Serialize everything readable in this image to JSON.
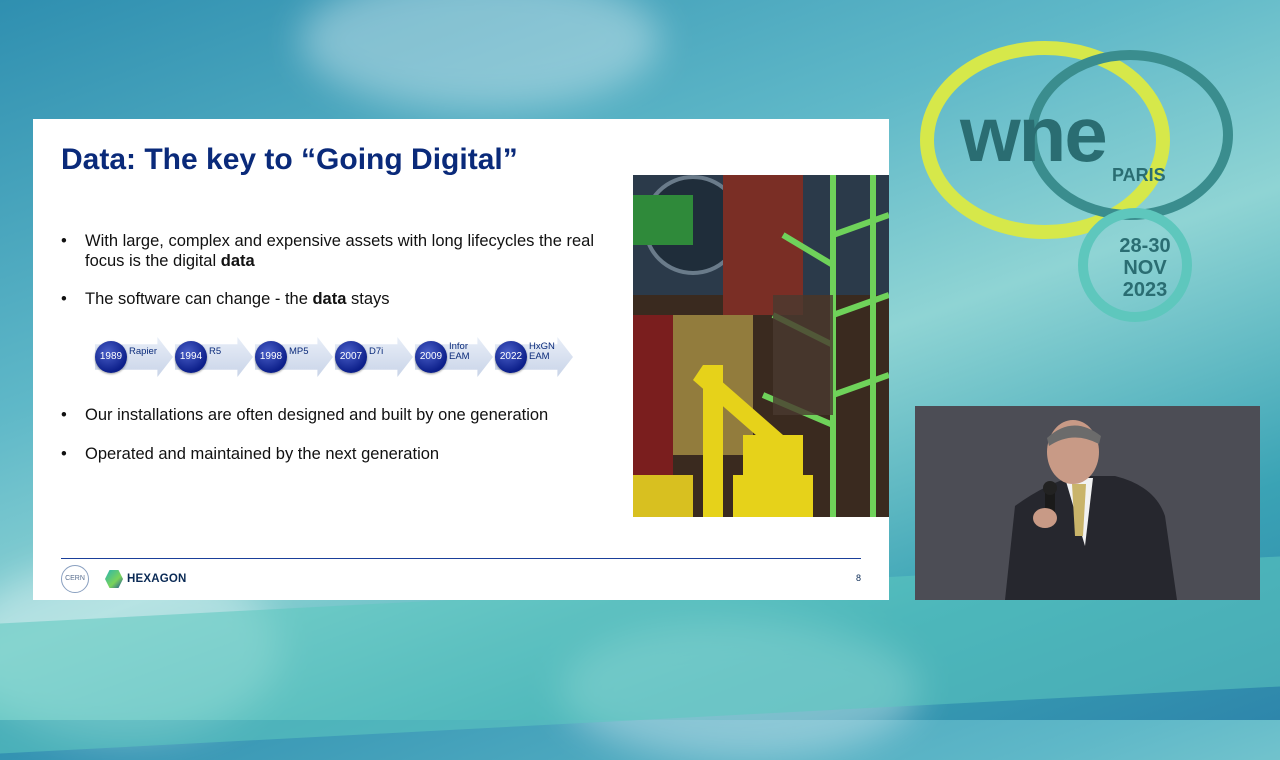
{
  "slide": {
    "title": "Data: The key to “Going Digital”",
    "bullets": [
      {
        "pre": "With large, complex and expensive assets with long lifecycles the real focus is the digital ",
        "bold": "data",
        "post": ""
      },
      {
        "pre": "The software can change - the ",
        "bold": "data",
        "post": " stays"
      },
      {
        "pre": "Our installations are often designed and built by one generation",
        "bold": "",
        "post": ""
      },
      {
        "pre": "Operated and maintained by the next generation",
        "bold": "",
        "post": ""
      }
    ],
    "timeline": [
      {
        "year": "1989",
        "label": "Rapier"
      },
      {
        "year": "1994",
        "label": "R5"
      },
      {
        "year": "1998",
        "label": "MP5"
      },
      {
        "year": "2007",
        "label": "D7i"
      },
      {
        "year": "2009",
        "label": "Infor EAM"
      },
      {
        "year": "2022",
        "label": "HxGN EAM"
      }
    ],
    "footer": {
      "cern_label": "CERN",
      "hexagon_label": "HEXAGON",
      "page_number": "8"
    }
  },
  "event": {
    "logo_text": "wne",
    "city": "PARIS",
    "dates": "28-30",
    "month": "NOV",
    "year": "2023"
  },
  "colors": {
    "title_blue": "#0a2a7a",
    "wne_teal": "#2a6d72",
    "wne_lime": "#d6e84a",
    "timeline_circle": "#0c1f8a"
  }
}
